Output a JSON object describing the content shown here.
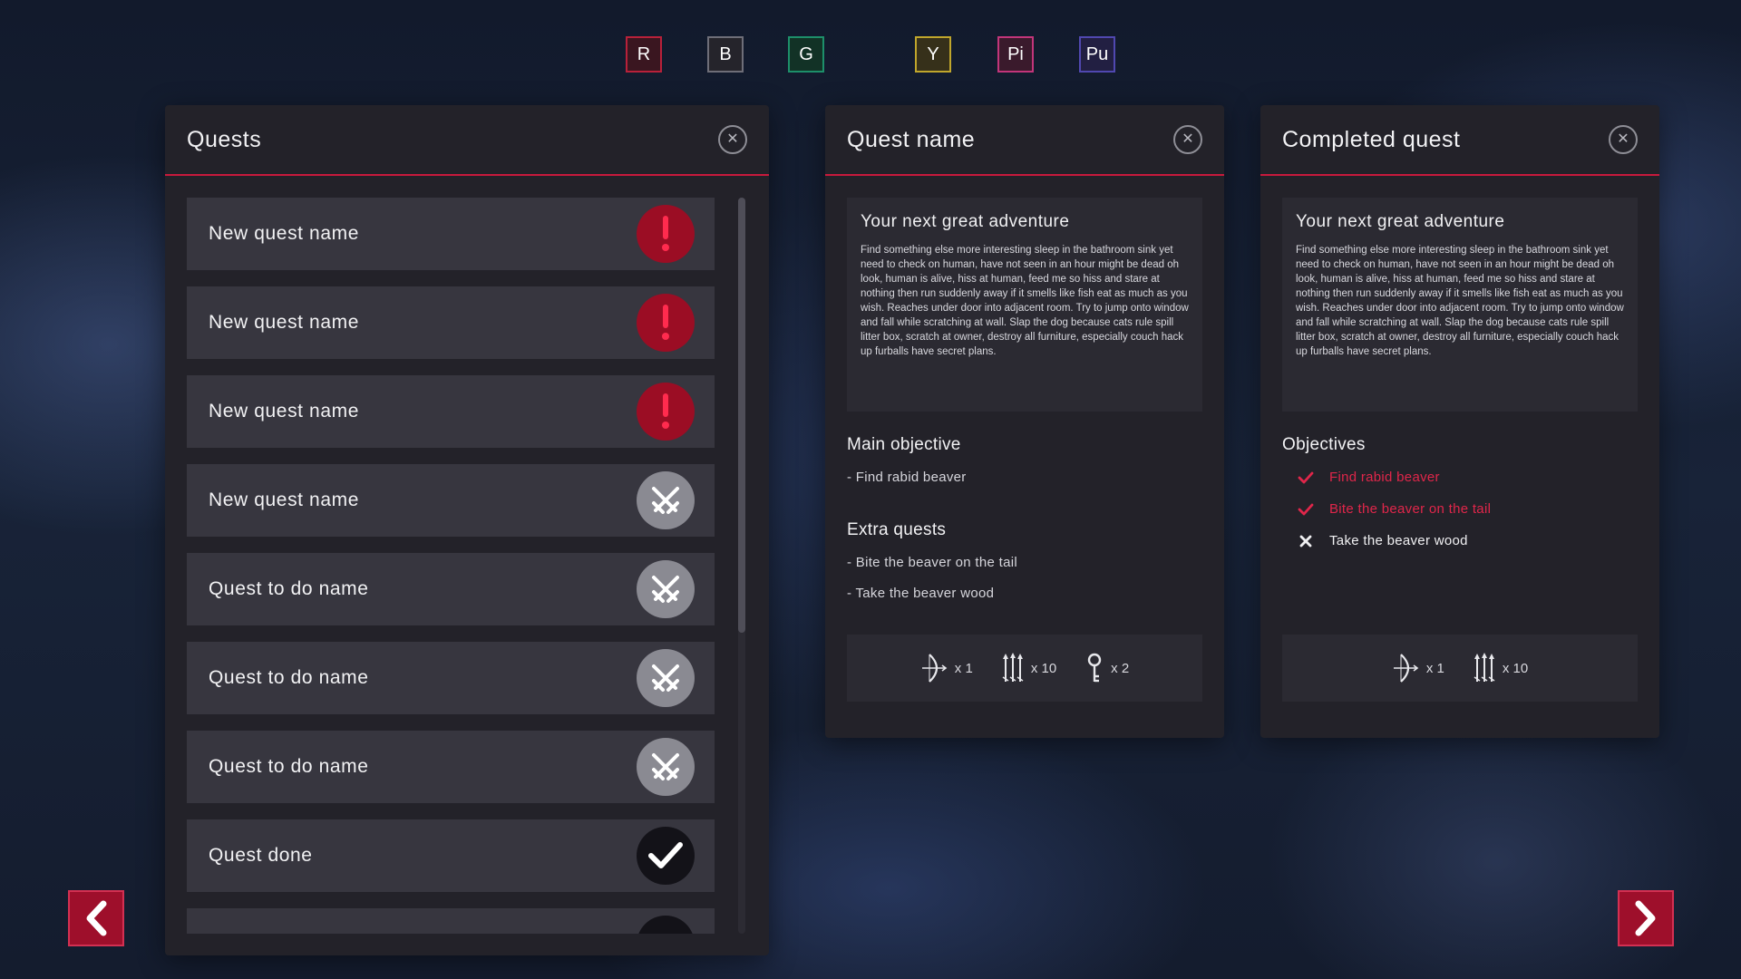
{
  "color_tabs": [
    {
      "label": "R",
      "color": "#b8213a",
      "bg": "#3a1620"
    },
    {
      "label": "B",
      "color": "#6e6e78",
      "bg": "#25242b"
    },
    {
      "label": "G",
      "color": "#1d8f6a",
      "bg": "#123226"
    },
    {
      "label": "Y",
      "color": "#c0a62c",
      "bg": "#36301a"
    },
    {
      "label": "Pi",
      "color": "#c2357a",
      "bg": "#3a1a2c"
    },
    {
      "label": "Pu",
      "color": "#5048b0",
      "bg": "#221f42"
    }
  ],
  "quests_panel": {
    "title": "Quests",
    "items": [
      {
        "label": "New quest name",
        "status": "urgent",
        "icon": "exclamation-icon"
      },
      {
        "label": "New quest name",
        "status": "urgent",
        "icon": "exclamation-icon"
      },
      {
        "label": "New quest name",
        "status": "urgent",
        "icon": "exclamation-icon"
      },
      {
        "label": "New quest name",
        "status": "todo",
        "icon": "crossed-swords-icon"
      },
      {
        "label": "Quest to do name",
        "status": "todo",
        "icon": "crossed-swords-icon"
      },
      {
        "label": "Quest to do name",
        "status": "todo",
        "icon": "crossed-swords-icon"
      },
      {
        "label": "Quest to do name",
        "status": "todo",
        "icon": "crossed-swords-icon"
      },
      {
        "label": "Quest done",
        "status": "done",
        "icon": "checkmark-icon"
      }
    ]
  },
  "quest_detail": {
    "title": "Quest name",
    "heading": "Your next great adventure",
    "description": "Find something else more interesting sleep in the bathroom sink yet need to check on human, have not seen in an hour might be dead oh look, human is alive, hiss at human, feed me so hiss and stare at nothing then run suddenly away if it smells like fish eat as much as you wish. Reaches under door into adjacent room. Try to jump onto window and fall while scratching at wall. Slap the dog because cats rule spill litter box, scratch at owner, destroy all furniture, especially couch hack up furballs have secret plans.",
    "main_objective_title": "Main objective",
    "main_objective": "- Find rabid beaver",
    "extra_title": "Extra quests",
    "extra": [
      "- Bite the beaver on the tail",
      "- Take the beaver wood"
    ],
    "rewards": [
      {
        "icon": "bow-icon",
        "count": "x 1"
      },
      {
        "icon": "arrows-icon",
        "count": "x 10"
      },
      {
        "icon": "key-icon",
        "count": "x 2"
      }
    ]
  },
  "completed_detail": {
    "title": "Completed quest",
    "heading": "Your next great adventure",
    "description": "Find something else more interesting sleep in the bathroom sink yet need to check on human, have not seen in an hour might be dead oh look, human is alive, hiss at human, feed me so hiss and stare at nothing then run suddenly away if it smells like fish eat as much as you wish. Reaches under door into adjacent room. Try to jump onto window and fall while scratching at wall. Slap the dog because cats rule spill litter box, scratch at owner, destroy all furniture, especially couch hack up furballs have secret plans.",
    "objectives_title": "Objectives",
    "objectives": [
      {
        "label": "Find rabid beaver",
        "done": true,
        "color": "#e0264a"
      },
      {
        "label": "Bite the beaver on the tail",
        "done": true,
        "color": "#e0264a"
      },
      {
        "label": "Take the beaver wood",
        "done": false,
        "color": "#f0f0f2"
      }
    ],
    "rewards": [
      {
        "icon": "bow-icon",
        "count": "x 1"
      },
      {
        "icon": "arrows-icon",
        "count": "x 10"
      }
    ]
  },
  "nav": {
    "prev_icon": "chevron-left-icon",
    "next_icon": "chevron-right-icon"
  },
  "accent_color": "#c8193c"
}
